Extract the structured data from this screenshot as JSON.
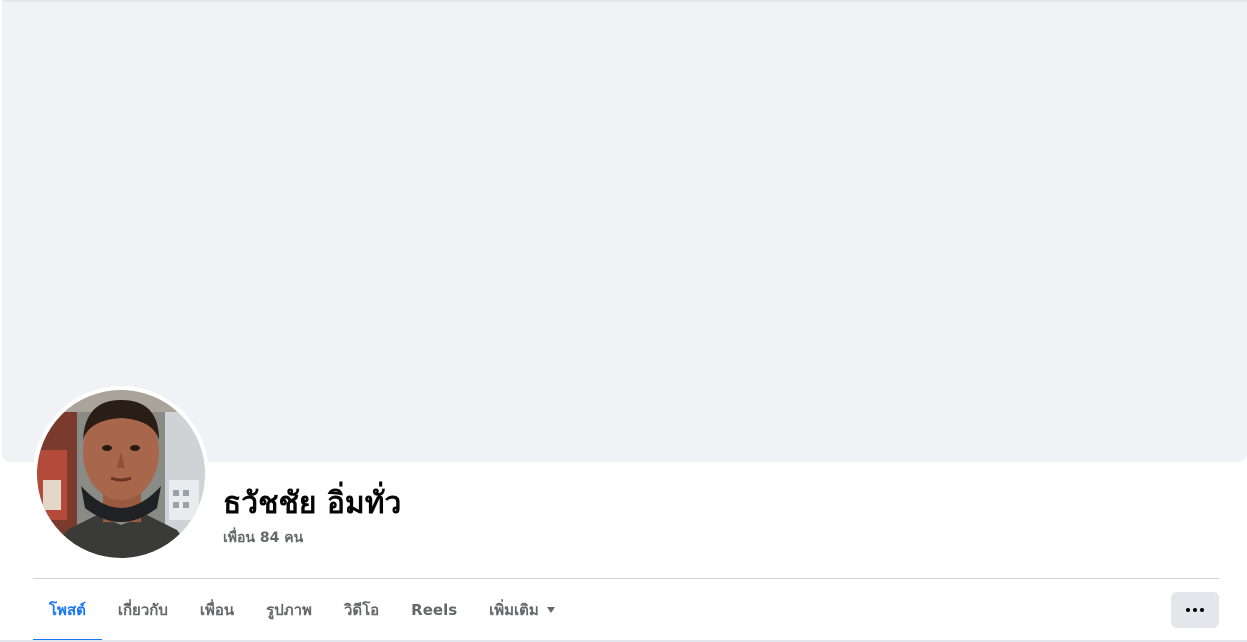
{
  "profile": {
    "name": "ธวัชชัย อิ่มทั่ว",
    "friends_text": "เพื่อน 84 คน"
  },
  "tabs": [
    {
      "label": "โพสต์",
      "active": true
    },
    {
      "label": "เกี่ยวกับ",
      "active": false
    },
    {
      "label": "เพื่อน",
      "active": false
    },
    {
      "label": "รูปภาพ",
      "active": false
    },
    {
      "label": "วิดีโอ",
      "active": false
    },
    {
      "label": "Reels",
      "active": false
    },
    {
      "label": "เพิ่มเติม",
      "active": false
    }
  ],
  "colors": {
    "accent": "#1877f2",
    "cover": "#f0f2f5",
    "secondary_text": "#65676b",
    "button_bg": "#e4e6eb"
  },
  "icons": {
    "more_tab": "caret-down-icon",
    "more_button": "more-horizontal-icon"
  }
}
